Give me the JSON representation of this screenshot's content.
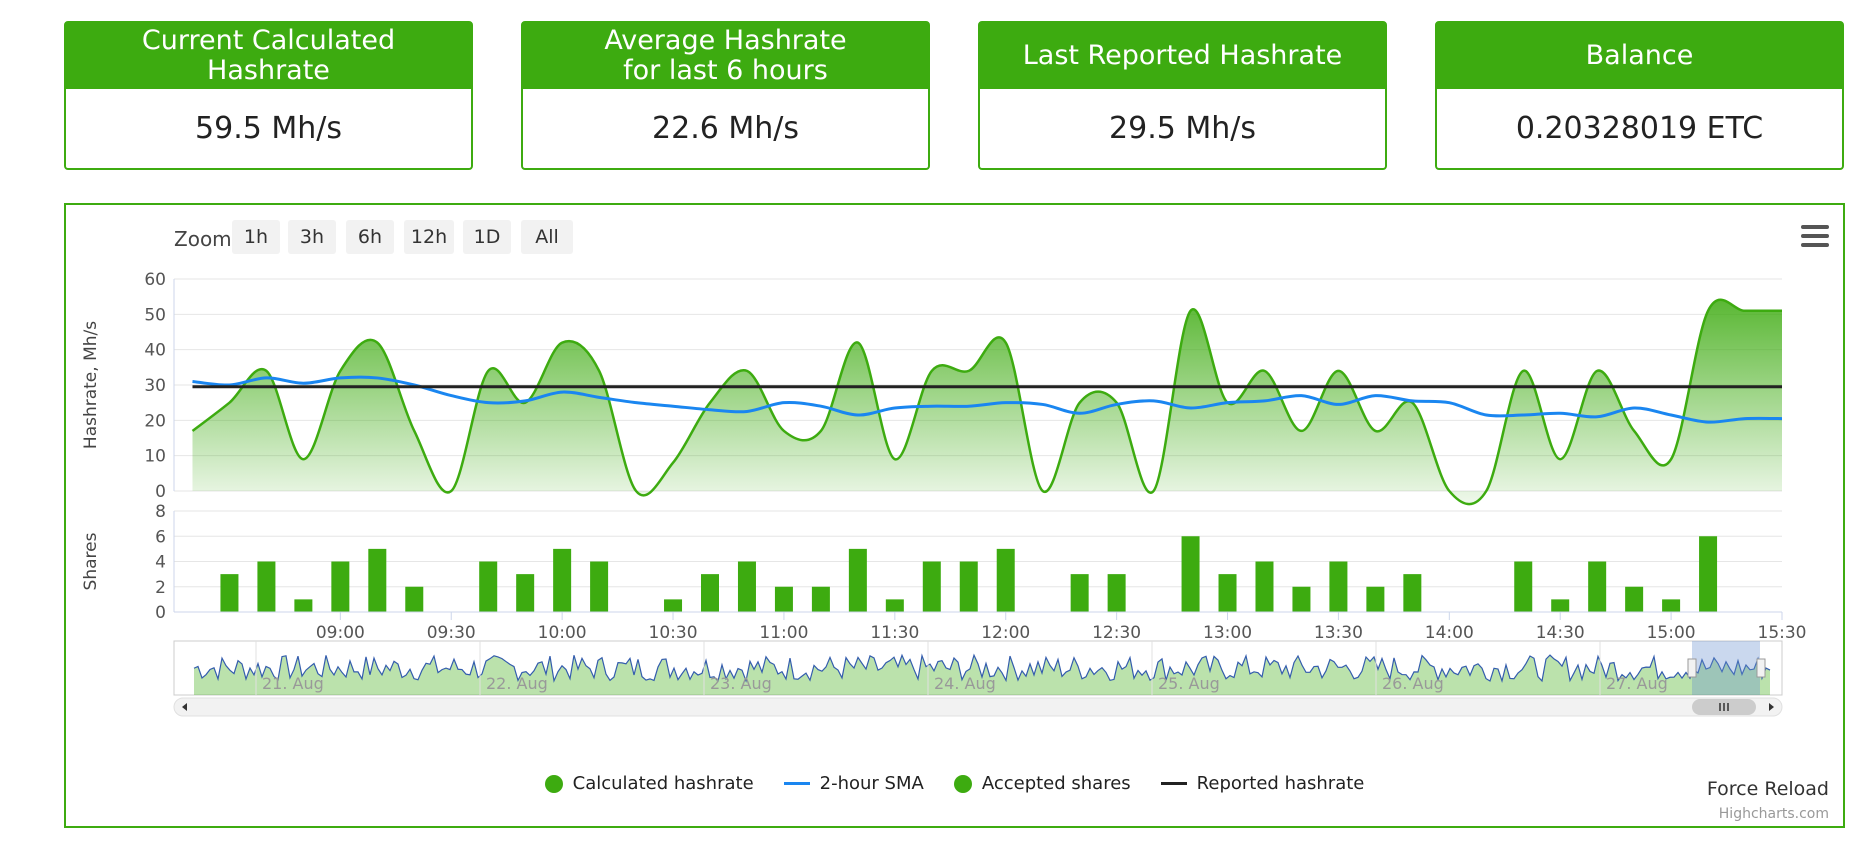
{
  "stats": [
    {
      "title": "Current Calculated\nHashrate",
      "value": "59.5 Mh/s"
    },
    {
      "title": "Average Hashrate\nfor last 6 hours",
      "value": "22.6 Mh/s"
    },
    {
      "title": "Last Reported Hashrate",
      "value": "29.5 Mh/s"
    },
    {
      "title": "Balance",
      "value": "0.20328019 ETC"
    }
  ],
  "zoom": {
    "label": "Zoom",
    "buttons": [
      "1h",
      "3h",
      "6h",
      "12h",
      "1D",
      "All"
    ]
  },
  "legend": [
    {
      "name": "Calculated hashrate",
      "kind": "dot",
      "color": "#3dab10"
    },
    {
      "name": "2-hour SMA",
      "kind": "line",
      "color": "#1a86f0"
    },
    {
      "name": "Accepted shares",
      "kind": "dot",
      "color": "#3dab10"
    },
    {
      "name": "Reported hashrate",
      "kind": "line",
      "color": "#222222"
    }
  ],
  "force_reload": "Force Reload",
  "credits": "Highcharts.com",
  "chart_data": {
    "type": "area",
    "x_ticks": [
      "09:00",
      "09:30",
      "10:00",
      "10:30",
      "11:00",
      "11:30",
      "12:00",
      "12:30",
      "13:00",
      "13:30",
      "14:00",
      "14:30",
      "15:00",
      "15:30"
    ],
    "hashrate_axis": {
      "label": "Hashrate, Mh/s",
      "ticks": [
        0,
        10,
        20,
        30,
        40,
        50,
        60
      ],
      "ylim": [
        0,
        60
      ]
    },
    "shares_axis": {
      "label": "Shares",
      "ticks": [
        0,
        2,
        4,
        6,
        8
      ],
      "ylim": [
        0,
        8
      ]
    },
    "x_minutes_range": [
      495,
      930
    ],
    "calculated_hashrate": {
      "name": "Calculated hashrate",
      "color": "#3dab10",
      "x_minutes": [
        500,
        510,
        520,
        530,
        540,
        550,
        560,
        570,
        580,
        590,
        600,
        610,
        620,
        630,
        640,
        650,
        660,
        670,
        680,
        690,
        700,
        710,
        720,
        730,
        740,
        750,
        760,
        770,
        780,
        790,
        800,
        810,
        820,
        830,
        840,
        850,
        860,
        870,
        880,
        890,
        900,
        910,
        920,
        930
      ],
      "values": [
        17,
        25,
        34,
        9,
        34,
        42,
        17,
        0,
        34,
        25,
        42,
        34,
        0,
        8,
        25,
        34,
        17,
        17,
        42,
        9,
        34,
        34,
        42,
        0,
        25,
        25,
        0,
        51,
        25,
        34,
        17,
        34,
        17,
        25,
        0,
        0,
        34,
        9,
        34,
        17,
        9,
        51,
        51,
        51
      ]
    },
    "sma_2h": {
      "name": "2-hour SMA",
      "color": "#1a86f0",
      "x_minutes": [
        500,
        510,
        520,
        530,
        540,
        550,
        560,
        570,
        580,
        590,
        600,
        610,
        620,
        630,
        640,
        650,
        660,
        670,
        680,
        690,
        700,
        710,
        720,
        730,
        740,
        750,
        760,
        770,
        780,
        790,
        800,
        810,
        820,
        830,
        840,
        850,
        860,
        870,
        880,
        890,
        900,
        910,
        920,
        930
      ],
      "values": [
        31,
        30,
        32,
        30.5,
        32,
        32,
        30,
        27,
        25,
        25.5,
        28,
        26.5,
        25,
        24,
        23,
        22.5,
        25,
        24,
        21.5,
        23.5,
        24,
        24,
        25,
        24.5,
        22,
        24.5,
        25.5,
        23.5,
        25,
        25.5,
        27,
        24.5,
        27,
        25.5,
        25,
        21.5,
        21.5,
        22,
        21,
        23.5,
        21.5,
        19.5,
        20.5,
        20.5
      ]
    },
    "reported_hashrate": {
      "name": "Reported hashrate",
      "color": "#222222",
      "x_minutes": [
        500,
        930
      ],
      "values": [
        29.5,
        29.5
      ]
    },
    "accepted_shares": {
      "name": "Accepted shares",
      "color": "#3dab10",
      "x_minutes": [
        510,
        520,
        530,
        540,
        550,
        560,
        580,
        590,
        600,
        610,
        630,
        640,
        650,
        660,
        670,
        680,
        690,
        700,
        710,
        720,
        740,
        750,
        770,
        780,
        790,
        800,
        810,
        820,
        830,
        860,
        870,
        880,
        890,
        900,
        910
      ],
      "values": [
        3,
        4,
        1,
        4,
        5,
        2,
        4,
        3,
        5,
        4,
        1,
        3,
        4,
        2,
        2,
        5,
        1,
        4,
        4,
        5,
        3,
        3,
        6,
        3,
        4,
        2,
        4,
        2,
        3,
        4,
        1,
        4,
        2,
        1,
        6
      ]
    },
    "navigator": {
      "labels": [
        "21. Aug",
        "22. Aug",
        "23. Aug",
        "24. Aug",
        "25. Aug",
        "26. Aug",
        "27. Aug"
      ]
    }
  }
}
